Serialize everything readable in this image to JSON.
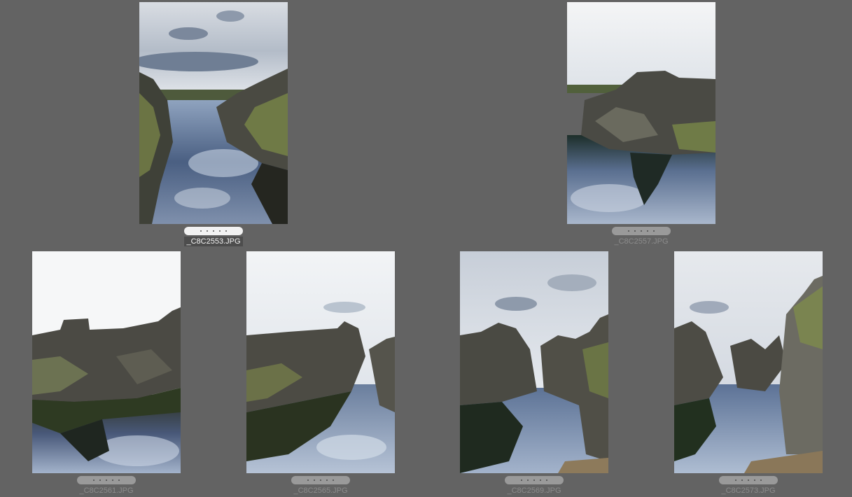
{
  "app": {
    "background": "#636363",
    "selection_color": "#f2f2f2"
  },
  "thumbnails": [
    {
      "filename": "_C8C2553.JPG",
      "selected": true,
      "rating": 0,
      "scene": "canyon-left-cliff"
    },
    {
      "filename": "_C8C2557.JPG",
      "selected": false,
      "rating": 0,
      "scene": "rock-island-reflection"
    },
    {
      "filename": "_C8C2561.JPG",
      "selected": false,
      "rating": 0,
      "scene": "rock-wall-reflection"
    },
    {
      "filename": "_C8C2565.JPG",
      "selected": false,
      "rating": 0,
      "scene": "rock-wall-water-channel"
    },
    {
      "filename": "_C8C2569.JPG",
      "selected": false,
      "rating": 0,
      "scene": "fissure-cloudy-sky"
    },
    {
      "filename": "_C8C2573.JPG",
      "selected": false,
      "rating": 0,
      "scene": "fissure-right-cliff"
    }
  ]
}
